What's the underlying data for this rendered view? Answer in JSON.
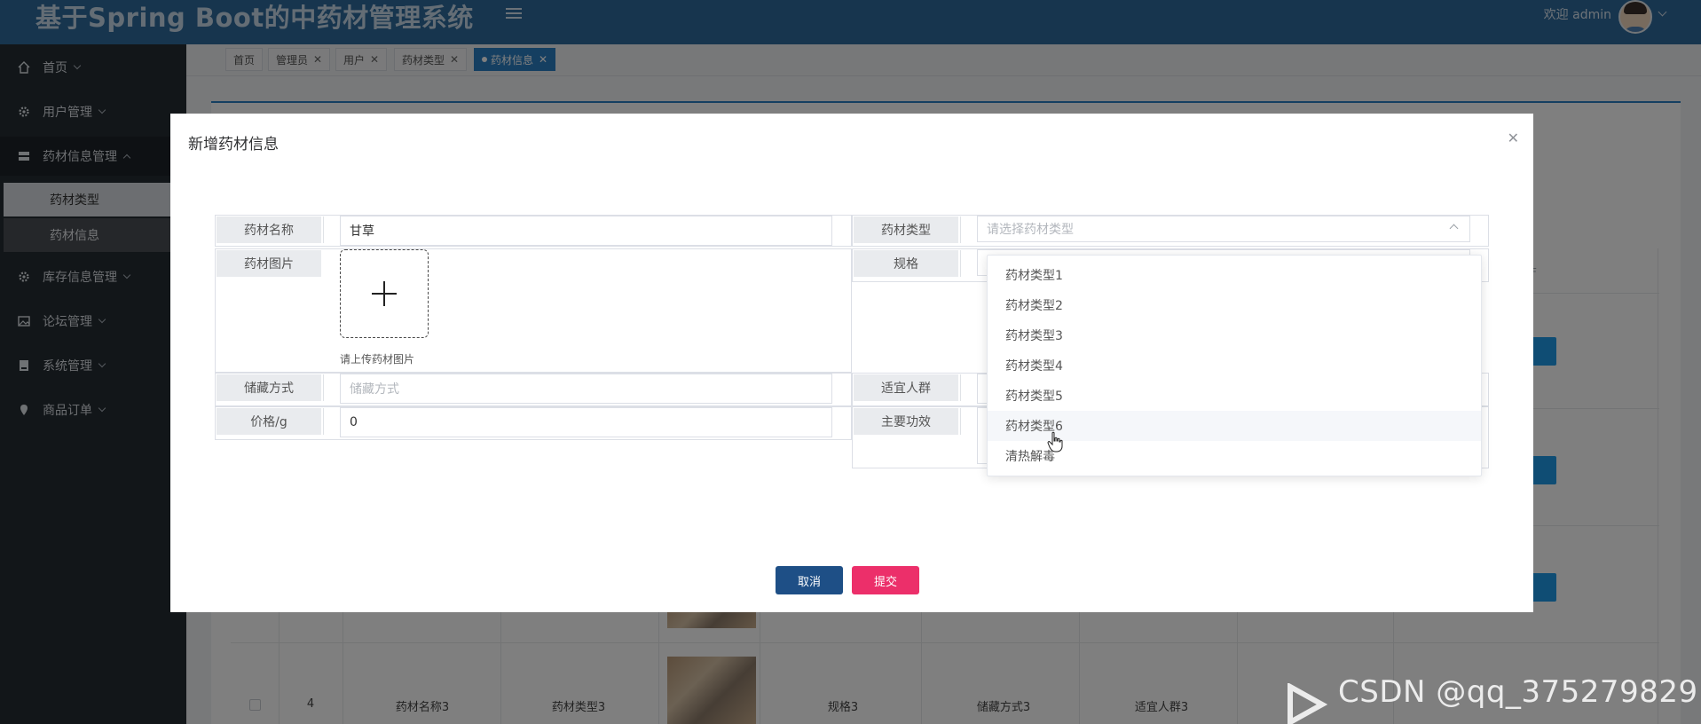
{
  "header": {
    "app_title": "基于Spring Boot的中药材管理系统",
    "welcome": "欢迎 admin"
  },
  "sidebar": {
    "items": [
      {
        "label": "首页",
        "icon": "home-icon"
      },
      {
        "label": "用户管理",
        "icon": "gear-icon"
      },
      {
        "label": "药材信息管理",
        "icon": "server-icon"
      },
      {
        "label": "库存信息管理",
        "icon": "gear-icon"
      },
      {
        "label": "论坛管理",
        "icon": "image-icon"
      },
      {
        "label": "系统管理",
        "icon": "folder-icon"
      },
      {
        "label": "商品订单",
        "icon": "location-icon"
      }
    ],
    "sub_items": [
      "药材类型",
      "药材信息"
    ]
  },
  "tabs": [
    {
      "label": "首页"
    },
    {
      "label": "管理员"
    },
    {
      "label": "用户"
    },
    {
      "label": "药材类型"
    },
    {
      "label": "药材信息",
      "active": true
    }
  ],
  "background_table": {
    "row": {
      "index": "4",
      "name": "药材名称3",
      "type": "药材类型3",
      "spec": "规格3",
      "storage": "储藏方式3",
      "crowd": "适宜人群3"
    },
    "header_fragment": "F"
  },
  "dialog": {
    "title": "新增药材信息",
    "fields": {
      "name": {
        "label": "药材名称",
        "value": "甘草"
      },
      "type": {
        "label": "药材类型",
        "placeholder": "请选择药材类型"
      },
      "image": {
        "label": "药材图片",
        "tip": "请上传药材图片"
      },
      "spec": {
        "label": "规格"
      },
      "storage": {
        "label": "储藏方式",
        "placeholder": "储藏方式"
      },
      "crowd": {
        "label": "适宜人群"
      },
      "price": {
        "label": "价格/g",
        "value": "0"
      },
      "effect": {
        "label": "主要功效"
      }
    },
    "type_options": [
      "药材类型1",
      "药材类型2",
      "药材类型3",
      "药材类型4",
      "药材类型5",
      "药材类型6",
      "清热解毒"
    ],
    "hovered_option": "药材类型6",
    "buttons": {
      "cancel": "取消",
      "submit": "提交"
    }
  },
  "watermark": "CSDN @qq_375279829",
  "colors": {
    "header": "#2f6a9c",
    "sidebar": "#252c33",
    "active_tab": "#2a7ec2",
    "cancel_button": "#1e4f86",
    "submit_button": "#ec2f6a"
  }
}
